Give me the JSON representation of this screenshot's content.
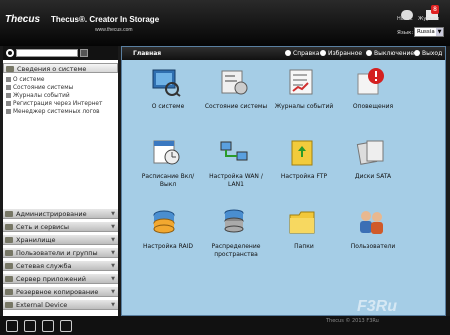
{
  "header": {
    "logo": "Thecus",
    "slogan": "Thecus®. Creator In Storage",
    "site": "www.thecus.com",
    "news_label": "Новос",
    "log_label": "Журнал",
    "log_count": "8",
    "language_label": "Язык:",
    "language_value": "Russia"
  },
  "sidebar": {
    "search_placeholder": "",
    "sections": [
      {
        "label": "Сведения о системе",
        "open": true,
        "items": [
          "О системе",
          "Состояние системы",
          "Журналы событий",
          "Регистрация через Интернет",
          "Менеджер системных логов"
        ]
      },
      {
        "label": "Администрирование"
      },
      {
        "label": "Сеть и сервисы"
      },
      {
        "label": "Хранилище"
      },
      {
        "label": "Пользователи и группы"
      },
      {
        "label": "Сетевая служба"
      },
      {
        "label": "Сервер приложений"
      },
      {
        "label": "Резервное копирование"
      },
      {
        "label": "External Device"
      }
    ]
  },
  "content": {
    "breadcrumb": "Главная",
    "links": [
      "Справка",
      "Избранное",
      "Выключение",
      "Выход"
    ],
    "tiles": [
      {
        "label": "О системе",
        "icon": "system-info-icon"
      },
      {
        "label": "Состояние системы",
        "icon": "system-status-icon"
      },
      {
        "label": "Журналы событий",
        "icon": "event-logs-icon"
      },
      {
        "label": "Оповещения",
        "icon": "notification-icon"
      },
      {
        "label": "Расписание Вкл/Выкл",
        "icon": "schedule-icon"
      },
      {
        "label": "Настройка WAN / LAN1",
        "icon": "network-icon"
      },
      {
        "label": "Настройка FTP",
        "icon": "ftp-icon"
      },
      {
        "label": "Диски SATA",
        "icon": "disk-icon"
      },
      {
        "label": "Настройка RAID",
        "icon": "raid-icon"
      },
      {
        "label": "Распределение пространства",
        "icon": "space-allocation-icon"
      },
      {
        "label": "Папки",
        "icon": "folder-icon"
      },
      {
        "label": "Пользователи",
        "icon": "users-icon"
      }
    ]
  },
  "watermark": {
    "text": "F3Ru",
    "caption": "Thecus © 2013 F3Ru"
  }
}
